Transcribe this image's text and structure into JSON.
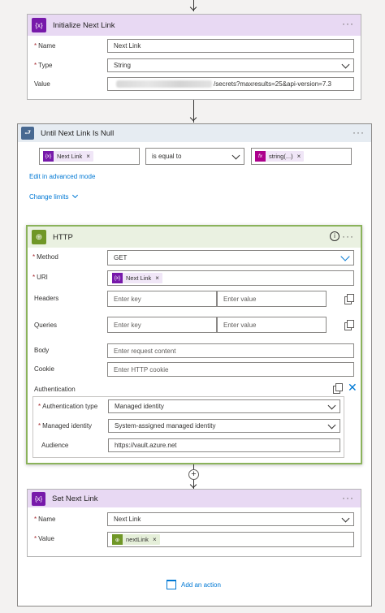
{
  "init_card": {
    "title": "Initialize Next Link",
    "icon_text": "{x}",
    "name_label": "Name",
    "name_value": "Next Link",
    "type_label": "Type",
    "type_value": "String",
    "value_label": "Value",
    "value_text": "/secrets?maxresults=25&api-version=7.3"
  },
  "until_card": {
    "title": "Until Next Link Is Null",
    "cond_token": "Next Link",
    "cond_token_icon": "{x}",
    "operator": "is equal to",
    "fx_token": "string(...)",
    "fx_icon": "fx",
    "advanced_link": "Edit in advanced mode",
    "change_limits": "Change limits"
  },
  "http_card": {
    "title": "HTTP",
    "method_label": "Method",
    "method_value": "GET",
    "uri_label": "URI",
    "uri_token": "Next Link",
    "uri_token_icon": "{x}",
    "headers_label": "Headers",
    "headers_key_ph": "Enter key",
    "headers_value_ph": "Enter value",
    "queries_label": "Queries",
    "queries_key_ph": "Enter key",
    "queries_value_ph": "Enter value",
    "body_label": "Body",
    "body_ph": "Enter request content",
    "cookie_label": "Cookie",
    "cookie_ph": "Enter HTTP cookie",
    "auth_label": "Authentication",
    "auth_type_label": "Authentication type",
    "auth_type_value": "Managed identity",
    "managed_identity_label": "Managed identity",
    "managed_identity_value": "System-assigned managed identity",
    "audience_label": "Audience",
    "audience_value": "https://vault.azure.net"
  },
  "set_card": {
    "title": "Set Next Link",
    "icon_text": "{x}",
    "name_label": "Name",
    "name_value": "Next Link",
    "value_label": "Value",
    "value_token": "nextLink"
  },
  "add_action": "Add an action",
  "colors": {
    "variable": "#7719aa",
    "http": "#709727",
    "loop": "#486991",
    "link": "#0078d4"
  }
}
